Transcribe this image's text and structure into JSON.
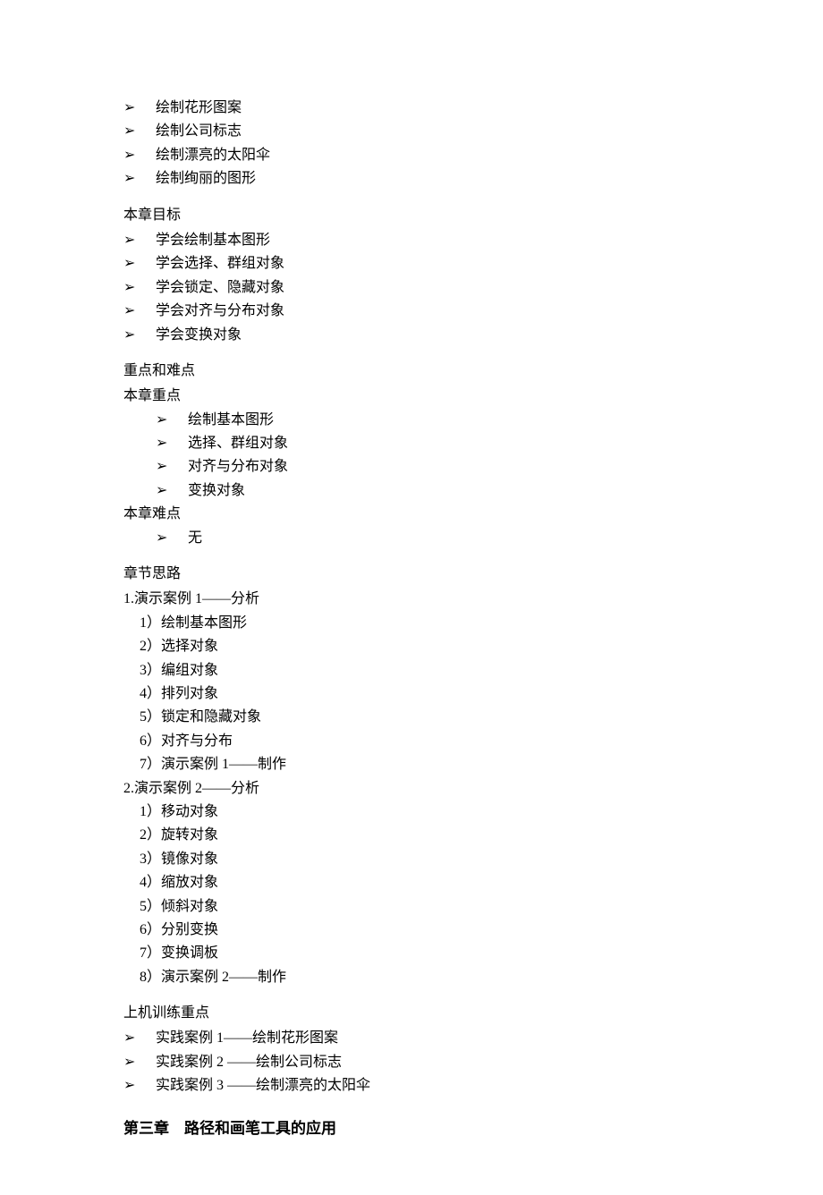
{
  "topList": [
    "绘制花形图案",
    "绘制公司标志",
    "绘制漂亮的太阳伞",
    "绘制绚丽的图形"
  ],
  "goalsHeading": "本章目标",
  "goals": [
    "学会绘制基本图形",
    "学会选择、群组对象",
    "学会锁定、隐藏对象",
    "学会对齐与分布对象",
    "学会变换对象"
  ],
  "keyDiffHeading": "重点和难点",
  "keyHeading": "本章重点",
  "keyPoints": [
    "绘制基本图形",
    "选择、群组对象",
    "对齐与分布对象",
    "变换对象"
  ],
  "diffHeading": "本章难点",
  "diffPoints": [
    "无"
  ],
  "ideasHeading": "章节思路",
  "demo1Heading": "1.演示案例 1——分析",
  "demo1": [
    "1）绘制基本图形",
    "2）选择对象",
    "3）编组对象",
    "4）排列对象",
    "5）锁定和隐藏对象",
    "6）对齐与分布",
    "7）演示案例 1——制作"
  ],
  "demo2Heading": "2.演示案例 2——分析",
  "demo2": [
    "1）移动对象",
    "2）旋转对象",
    "3）镜像对象",
    "4）缩放对象",
    "5）倾斜对象",
    "6）分别变换",
    "7）变换调板",
    "8）演示案例 2——制作"
  ],
  "labHeading": "上机训练重点",
  "labItems": [
    "实践案例 1——绘制花形图案",
    "实践案例 2 ——绘制公司标志",
    "实践案例 3 ——绘制漂亮的太阳伞"
  ],
  "chapterTitle": "第三章 路径和画笔工具的应用"
}
